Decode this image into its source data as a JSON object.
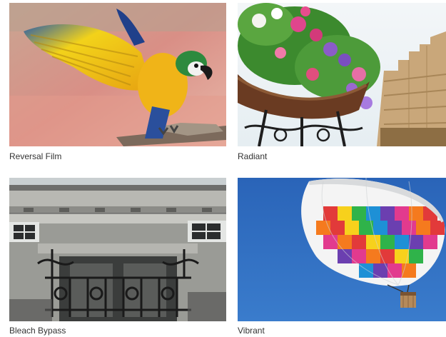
{
  "gallery": {
    "items": [
      {
        "label": "Reversal Film",
        "image": "parrot-photo"
      },
      {
        "label": "Radiant",
        "image": "flower-basket-photo"
      },
      {
        "label": "Bleach Bypass",
        "image": "building-balcony-photo"
      },
      {
        "label": "Vibrant",
        "image": "hot-air-balloon-photo"
      }
    ]
  }
}
